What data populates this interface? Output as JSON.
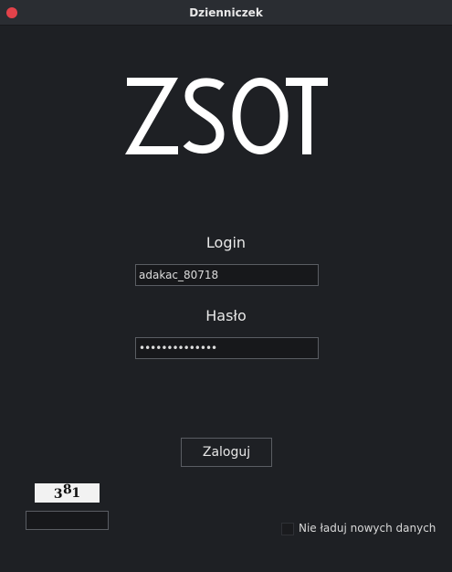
{
  "window": {
    "title": "Dzienniczek"
  },
  "logo": {
    "text": "ZSOT"
  },
  "form": {
    "login_label": "Login",
    "login_value": "adakac_80718",
    "password_label": "Hasło",
    "password_value": "••••••••••••••",
    "submit_label": "Zaloguj"
  },
  "captcha": {
    "digit_1": "3",
    "digit_2": "8",
    "digit_3": "1",
    "input_value": ""
  },
  "options": {
    "no_new_data_label": "Nie ładuj nowych danych",
    "no_new_data_checked": false
  },
  "colors": {
    "background": "#1e2024",
    "titlebar": "#2a2d32",
    "close_button": "#e2424a",
    "input_border": "#5a5d63",
    "logo": "#ffffff"
  }
}
